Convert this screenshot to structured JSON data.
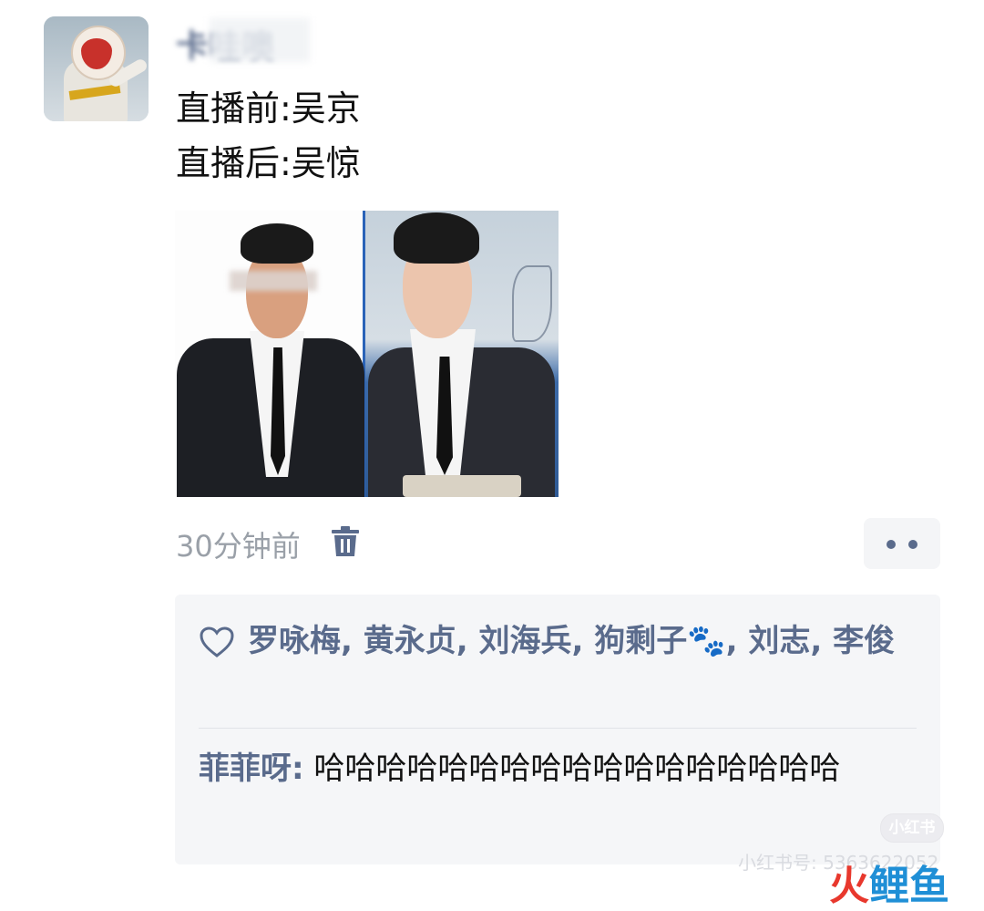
{
  "post": {
    "username": "卡哇噢",
    "line1": "直播前:吴京",
    "line2": "直播后:吴惊",
    "time": "30分钟前"
  },
  "likes": {
    "names": [
      "罗咏梅",
      "黄永贞",
      "刘海兵",
      "狗剩子🐾",
      "刘志",
      "李俊"
    ]
  },
  "comment": {
    "author": "菲菲呀:",
    "text": "哈哈哈哈哈哈哈哈哈哈哈哈哈哈哈哈哈"
  },
  "watermark": {
    "badge": "小红书",
    "id_text": "小红书号: 5363622052",
    "logo_huo": "火",
    "logo_li": "鲤",
    "logo_yu": "鱼"
  },
  "colors": {
    "name_link": "#5a6b8c",
    "time_gray": "#9aa0a8",
    "box_bg": "#f5f6f8"
  },
  "icons": [
    "trash-icon",
    "heart-icon",
    "more-dots-icon"
  ]
}
